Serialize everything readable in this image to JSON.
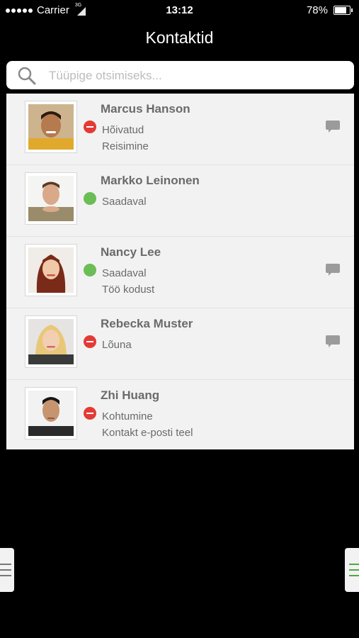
{
  "status_bar": {
    "carrier": "Carrier",
    "network_type": "3G",
    "time": "13:12",
    "battery": "78%",
    "battery_level": 0.78
  },
  "nav": {
    "title": "Kontaktid"
  },
  "search": {
    "placeholder": "Tüüpige otsimiseks..."
  },
  "contacts": [
    {
      "name": "Marcus Hanson",
      "status": "Hõivatud",
      "status_type": "busy",
      "note": "Reisimine",
      "has_chat": true
    },
    {
      "name": "Markko Leinonen",
      "status": "Saadaval",
      "status_type": "available",
      "note": "",
      "has_chat": false
    },
    {
      "name": "Nancy Lee",
      "status": "Saadaval",
      "status_type": "available",
      "note": "Töö kodust",
      "has_chat": true
    },
    {
      "name": "Rebecka Muster",
      "status": "Lõuna",
      "status_type": "busy",
      "note": "",
      "has_chat": true
    },
    {
      "name": "Zhi Huang",
      "status": "Kohtumine",
      "status_type": "busy",
      "note": "Kontakt e-posti teel",
      "has_chat": false
    }
  ],
  "colors": {
    "busy": "#e33a36",
    "available": "#6bbd55",
    "accent_green": "#50a845"
  }
}
